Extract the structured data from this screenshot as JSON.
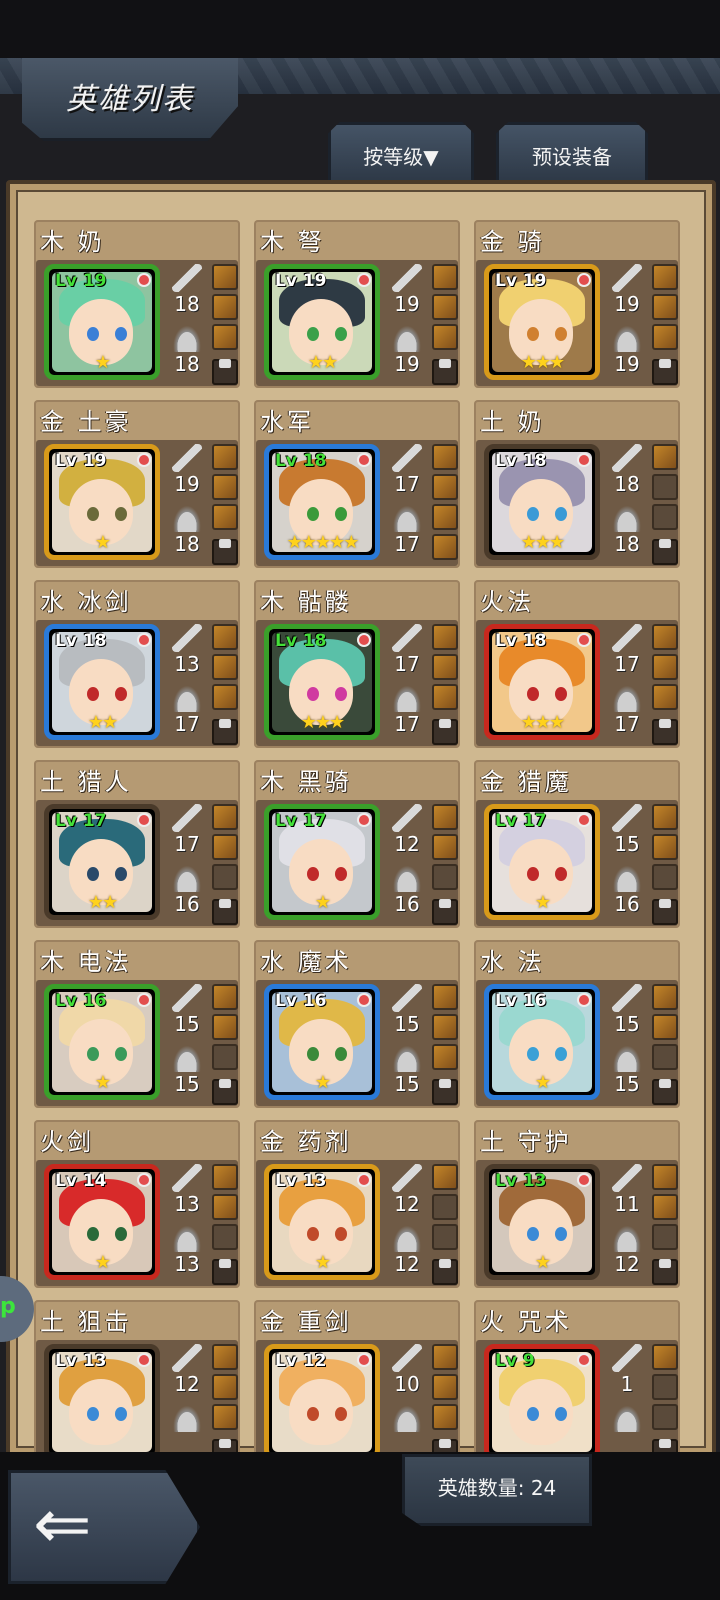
{
  "title": "英雄列表",
  "tabs": {
    "sort_label": "按等级▼",
    "preset_label": "预设装备"
  },
  "footer": {
    "hero_count_label": "英雄数量: 24"
  },
  "side_handle": {
    "label": "p"
  },
  "heroes": [
    {
      "name": "木 奶",
      "level": "Lv 19",
      "lv_green": true,
      "stars": "★",
      "attack": "18",
      "defense": "18",
      "frame": "#3aa02a",
      "bg": "#8ec4a0",
      "hair": "#69cfa5",
      "eyes": "#3a7fd6",
      "slots": [
        "item",
        "item",
        "item",
        "lock"
      ]
    },
    {
      "name": "木 弩",
      "level": "Lv 19",
      "lv_green": false,
      "stars": "★★",
      "attack": "19",
      "defense": "19",
      "frame": "#3aa02a",
      "bg": "#cbd9b8",
      "hair": "#2e3a44",
      "eyes": "#3aa04a",
      "slots": [
        "item",
        "item",
        "item",
        "lock"
      ]
    },
    {
      "name": "金 骑",
      "level": "Lv 19",
      "lv_green": false,
      "stars": "★★★",
      "attack": "19",
      "defense": "19",
      "frame": "#d89a1a",
      "bg": "#9e7a4a",
      "hair": "#f0d070",
      "eyes": "#d08030",
      "slots": [
        "item",
        "item",
        "item",
        "lock"
      ]
    },
    {
      "name": "金 土豪",
      "level": "Lv 19",
      "lv_green": false,
      "stars": "★",
      "attack": "19",
      "defense": "18",
      "frame": "#d89a1a",
      "bg": "#e2d8c8",
      "hair": "#d2b040",
      "eyes": "#6a6a3a",
      "slots": [
        "item",
        "item",
        "item",
        "lock"
      ]
    },
    {
      "name": "水军",
      "level": "Lv 18",
      "lv_green": true,
      "stars": "★★★★★",
      "attack": "17",
      "defense": "17",
      "frame": "#2a7ad8",
      "bg": "#d6d2cc",
      "hair": "#c87a30",
      "eyes": "#3a9a3a",
      "slots": [
        "item",
        "item",
        "item",
        "item"
      ]
    },
    {
      "name": "土 奶",
      "level": "Lv 18",
      "lv_green": false,
      "stars": "★★★",
      "attack": "18",
      "defense": "18",
      "frame": "#4a3a2a",
      "bg": "#dcd8dc",
      "hair": "#9a94b0",
      "eyes": "#3a9ad6",
      "slots": [
        "item",
        "empty",
        "empty",
        "lock"
      ]
    },
    {
      "name": "水 冰剑",
      "level": "Lv 18",
      "lv_green": false,
      "stars": "★★",
      "attack": "13",
      "defense": "17",
      "frame": "#2a7ad8",
      "bg": "#cfd6dc",
      "hair": "#b8bcc0",
      "eyes": "#c02a2a",
      "slots": [
        "item",
        "item",
        "item",
        "lock"
      ]
    },
    {
      "name": "木 骷髅",
      "level": "Lv 18",
      "lv_green": true,
      "stars": "★★★",
      "attack": "17",
      "defense": "17",
      "frame": "#3aa02a",
      "bg": "#3a4a3a",
      "hair": "#5ac0a8",
      "eyes": "#d03aa0",
      "slots": [
        "item",
        "item",
        "item",
        "lock"
      ]
    },
    {
      "name": "火法",
      "level": "Lv 18",
      "lv_green": false,
      "stars": "★★★",
      "attack": "17",
      "defense": "17",
      "frame": "#c8281e",
      "bg": "#f2c88a",
      "hair": "#e88a2a",
      "eyes": "#c0282a",
      "slots": [
        "item",
        "item",
        "item",
        "lock"
      ]
    },
    {
      "name": "土 猎人",
      "level": "Lv 17",
      "lv_green": true,
      "stars": "★★",
      "attack": "17",
      "defense": "16",
      "frame": "#4a3a2a",
      "bg": "#dcd4c8",
      "hair": "#2a6a7a",
      "eyes": "#2a4a6a",
      "slots": [
        "item",
        "item",
        "empty",
        "lock"
      ]
    },
    {
      "name": "木 黑骑",
      "level": "Lv 17",
      "lv_green": true,
      "stars": "★",
      "attack": "12",
      "defense": "16",
      "frame": "#3aa02a",
      "bg": "#c4c8cc",
      "hair": "#e0e0e6",
      "eyes": "#c02a2a",
      "slots": [
        "item",
        "item",
        "empty",
        "lock"
      ]
    },
    {
      "name": "金 猎魔",
      "level": "Lv 17",
      "lv_green": true,
      "stars": "★",
      "attack": "15",
      "defense": "16",
      "frame": "#d89a1a",
      "bg": "#e6e0dc",
      "hair": "#d4d0e0",
      "eyes": "#c02a2a",
      "slots": [
        "item",
        "item",
        "empty",
        "lock"
      ]
    },
    {
      "name": "木 电法",
      "level": "Lv 16",
      "lv_green": true,
      "stars": "★",
      "attack": "15",
      "defense": "15",
      "frame": "#3aa02a",
      "bg": "#d8ccc0",
      "hair": "#f0d8a8",
      "eyes": "#3a9a5a",
      "slots": [
        "item",
        "item",
        "empty",
        "lock"
      ]
    },
    {
      "name": "水 魔术",
      "level": "Lv 16",
      "lv_green": false,
      "stars": "★",
      "attack": "15",
      "defense": "15",
      "frame": "#2a7ad8",
      "bg": "#a8c0d8",
      "hair": "#e0b848",
      "eyes": "#3a8a3a",
      "slots": [
        "item",
        "item",
        "item",
        "lock"
      ]
    },
    {
      "name": "水 法",
      "level": "Lv 16",
      "lv_green": false,
      "stars": "★",
      "attack": "15",
      "defense": "15",
      "frame": "#2a7ad8",
      "bg": "#b8d8dc",
      "hair": "#9ad8d0",
      "eyes": "#3aa0d6",
      "slots": [
        "item",
        "item",
        "empty",
        "lock"
      ]
    },
    {
      "name": "火剑",
      "level": "Lv 14",
      "lv_green": false,
      "stars": "★",
      "attack": "13",
      "defense": "13",
      "frame": "#c8281e",
      "bg": "#d8c8b8",
      "hair": "#d82a2a",
      "eyes": "#2a6a3a",
      "slots": [
        "item",
        "item",
        "empty",
        "lock"
      ]
    },
    {
      "name": "金 药剂",
      "level": "Lv 13",
      "lv_green": false,
      "stars": "★",
      "attack": "12",
      "defense": "12",
      "frame": "#d89a1a",
      "bg": "#e8d8c0",
      "hair": "#e8a040",
      "eyes": "#c04a2a",
      "slots": [
        "item",
        "empty",
        "empty",
        "lock"
      ]
    },
    {
      "name": "土 守护",
      "level": "Lv 13",
      "lv_green": true,
      "stars": "★",
      "attack": "11",
      "defense": "12",
      "frame": "#4a3a2a",
      "bg": "#d4c8bc",
      "hair": "#a06a3a",
      "eyes": "#3a8ad6",
      "slots": [
        "item",
        "item",
        "empty",
        "lock"
      ]
    },
    {
      "name": "土 狙击",
      "level": "Lv 13",
      "lv_green": false,
      "stars": "",
      "attack": "12",
      "defense": "",
      "frame": "#4a3a2a",
      "bg": "#e8dcc8",
      "hair": "#e0a040",
      "eyes": "#3a8ad6",
      "slots": [
        "item",
        "item",
        "item",
        "lock"
      ]
    },
    {
      "name": "金 重剑",
      "level": "Lv 12",
      "lv_green": false,
      "stars": "",
      "attack": "10",
      "defense": "",
      "frame": "#d89a1a",
      "bg": "#e8dcc8",
      "hair": "#f0b060",
      "eyes": "#c04a2a",
      "slots": [
        "item",
        "item",
        "item",
        "lock"
      ]
    },
    {
      "name": "火 咒术",
      "level": "Lv 9",
      "lv_green": true,
      "stars": "",
      "attack": "1",
      "defense": "",
      "frame": "#c8281e",
      "bg": "#f0e0c8",
      "hair": "#f0d070",
      "eyes": "#3a8ad6",
      "slots": [
        "item",
        "empty",
        "empty",
        "lock"
      ]
    }
  ]
}
